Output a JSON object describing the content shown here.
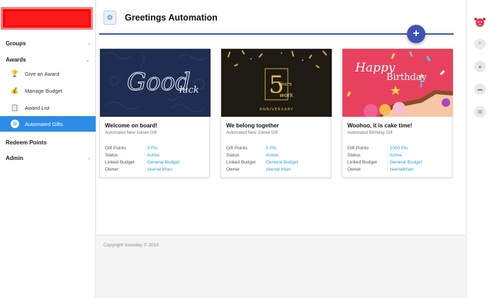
{
  "sidebar": {
    "sections": [
      {
        "label": "Groups",
        "chevron": "›"
      },
      {
        "label": "Awards",
        "chevron": "⌄"
      }
    ],
    "award_items": [
      {
        "label": "Give an Award",
        "icon": "trophy-hand-icon"
      },
      {
        "label": "Manage Budget",
        "icon": "coins-icon"
      },
      {
        "label": "Award List",
        "icon": "list-icon"
      },
      {
        "label": "Automated Gifts",
        "icon": "robot-gift-icon",
        "active": true
      }
    ],
    "redeem_label": "Redeem Points",
    "admin_label": "Admin",
    "admin_chevron": "›"
  },
  "header": {
    "title": "Greetings Automation",
    "add_button": "+"
  },
  "cards": [
    {
      "title": "Welcome on board!",
      "subtitle": "Automated New Joinee Gift",
      "image_text": "Good",
      "image_text2": "luck",
      "fields": [
        {
          "key": "Gift Points",
          "value": ": 0 Pts"
        },
        {
          "key": "Status",
          "value": ": Active"
        },
        {
          "key": "Linked Budget",
          "value": ": General Budget"
        },
        {
          "key": "Owner",
          "value": ": zeenat khan"
        }
      ]
    },
    {
      "title": "We belong together",
      "subtitle": "Automated New Joinee Gift",
      "image_text": "5",
      "image_text2": "Years",
      "image_text3": "work",
      "image_text4": "ANNIVERSARY",
      "fields": [
        {
          "key": "Gift Points",
          "value": "0 Pts"
        },
        {
          "key": "Status",
          "value": "Active"
        },
        {
          "key": "Linked Budget",
          "value": "General Budget"
        },
        {
          "key": "Owner",
          "value": "zeenat khan"
        }
      ]
    },
    {
      "title": "Woohoo, it is cake time!",
      "subtitle": "Automated Birthday Gift",
      "image_text": "Happy",
      "image_text2": "Birthday",
      "fields": [
        {
          "key": "Gift Points",
          "value": ": 1000 Pts"
        },
        {
          "key": "Status",
          "value": ": Active"
        },
        {
          "key": "Linked Budget",
          "value": ": General Budget"
        },
        {
          "key": "Owner",
          "value": ": zeenatkhan"
        }
      ]
    }
  ],
  "footer": {
    "copyright": "Copyright Xoxoday © 2019"
  },
  "rail": {
    "buttons": [
      "search-icon",
      "bell-icon",
      "cake-icon",
      "calendar-icon"
    ]
  },
  "colors": {
    "accent": "#3f51b5",
    "active_nav": "#2c8ce6",
    "link": "#2aa1d6",
    "brand_block": "#ff0000"
  }
}
